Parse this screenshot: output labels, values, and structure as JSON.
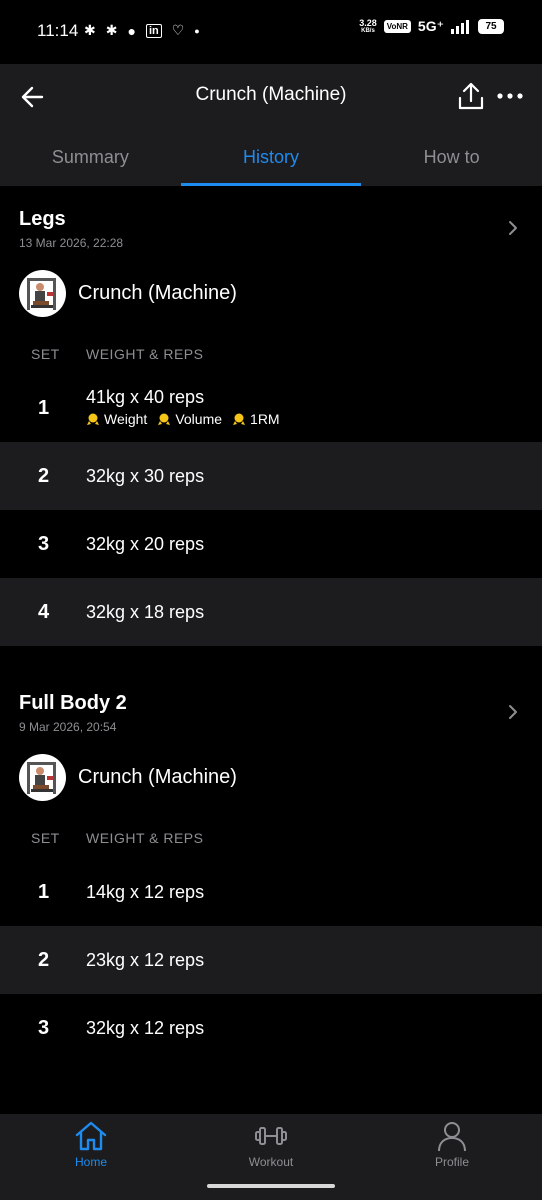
{
  "status_bar": {
    "time": "11:14",
    "speed_value": "3.28",
    "speed_unit": "KB/s",
    "vonr": "VoNR",
    "network": "5G⁺",
    "battery": "75"
  },
  "header": {
    "title": "Crunch (Machine)",
    "tabs": [
      {
        "label": "Summary"
      },
      {
        "label": "History"
      },
      {
        "label": "How to"
      }
    ],
    "active_tab": "History"
  },
  "workouts": [
    {
      "name": "Legs",
      "date": "13 Mar 2026, 22:28",
      "exercise": "Crunch (Machine)",
      "set_header": "SET",
      "weight_header": "WEIGHT & REPS",
      "sets": [
        {
          "num": "1",
          "value": "41kg x 40 reps",
          "badges": [
            "Weight",
            "Volume",
            "1RM"
          ]
        },
        {
          "num": "2",
          "value": "32kg x 30 reps"
        },
        {
          "num": "3",
          "value": "32kg x 20 reps"
        },
        {
          "num": "4",
          "value": "32kg x 18 reps"
        }
      ]
    },
    {
      "name": "Full Body 2",
      "date": "9 Mar 2026, 20:54",
      "exercise": "Crunch (Machine)",
      "set_header": "SET",
      "weight_header": "WEIGHT & REPS",
      "sets": [
        {
          "num": "1",
          "value": "14kg x 12 reps"
        },
        {
          "num": "2",
          "value": "23kg x 12 reps"
        },
        {
          "num": "3",
          "value": "32kg x 12 reps"
        }
      ]
    }
  ],
  "bottom_nav": [
    {
      "label": "Home",
      "icon": "home-icon"
    },
    {
      "label": "Workout",
      "icon": "dumbbell-icon"
    },
    {
      "label": "Profile",
      "icon": "person-icon"
    }
  ],
  "colors": {
    "accent": "#1e8bef",
    "background": "#000000",
    "surface": "#1c1c1e",
    "muted_text": "#8e8e93",
    "medal": "#f5c518"
  }
}
